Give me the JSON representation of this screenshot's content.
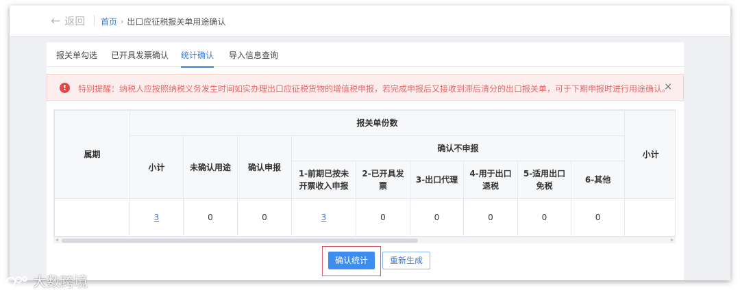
{
  "header": {
    "back_label": "返回",
    "breadcrumb_home": "首页",
    "breadcrumb_current": "出口应征税报关单用途确认"
  },
  "tabs": [
    {
      "label": "报关单勾选",
      "active": false
    },
    {
      "label": "已开具发票确认",
      "active": false
    },
    {
      "label": "统计确认",
      "active": true
    },
    {
      "label": "导入信息查询",
      "active": false
    }
  ],
  "alert": {
    "icon": "exclamation-icon",
    "message": "特别提醒：纳税人应按照纳税义务发生时间如实办理出口应征税货物的增值税申报，若完成申报后又接收到滞后清分的出口报关单，可于下期申报时进行用途确认。",
    "close_symbol": "×"
  },
  "table": {
    "col_period": "属期",
    "group_declarations": "报关单份数",
    "col_subtotal": "小计",
    "col_unconfirmed": "未确认用途",
    "col_confirm_declare": "确认申报",
    "group_confirm_not_declare": "确认不申报",
    "sub_cols": [
      "1-前期已按未开票收入申报",
      "2-已开具发票",
      "3-出口代理",
      "4-用于出口退税",
      "5-适用出口免税",
      "6-其他"
    ],
    "col_right_subtotal": "小计",
    "rows": [
      {
        "period": "",
        "subtotal": "3",
        "unconfirmed": "0",
        "confirm_declare": "0",
        "c1": "3",
        "c2": "0",
        "c3": "0",
        "c4": "0",
        "c5": "0",
        "c6": "0",
        "right_subtotal": ""
      }
    ]
  },
  "buttons": {
    "confirm_stats": "确认统计",
    "regenerate": "重新生成"
  },
  "watermark": "大数跨境",
  "colors": {
    "accent": "#3d8cf0",
    "alert_bg": "#fdeeee",
    "alert_text": "#e26a6a",
    "highlight_border": "#e0595f"
  }
}
